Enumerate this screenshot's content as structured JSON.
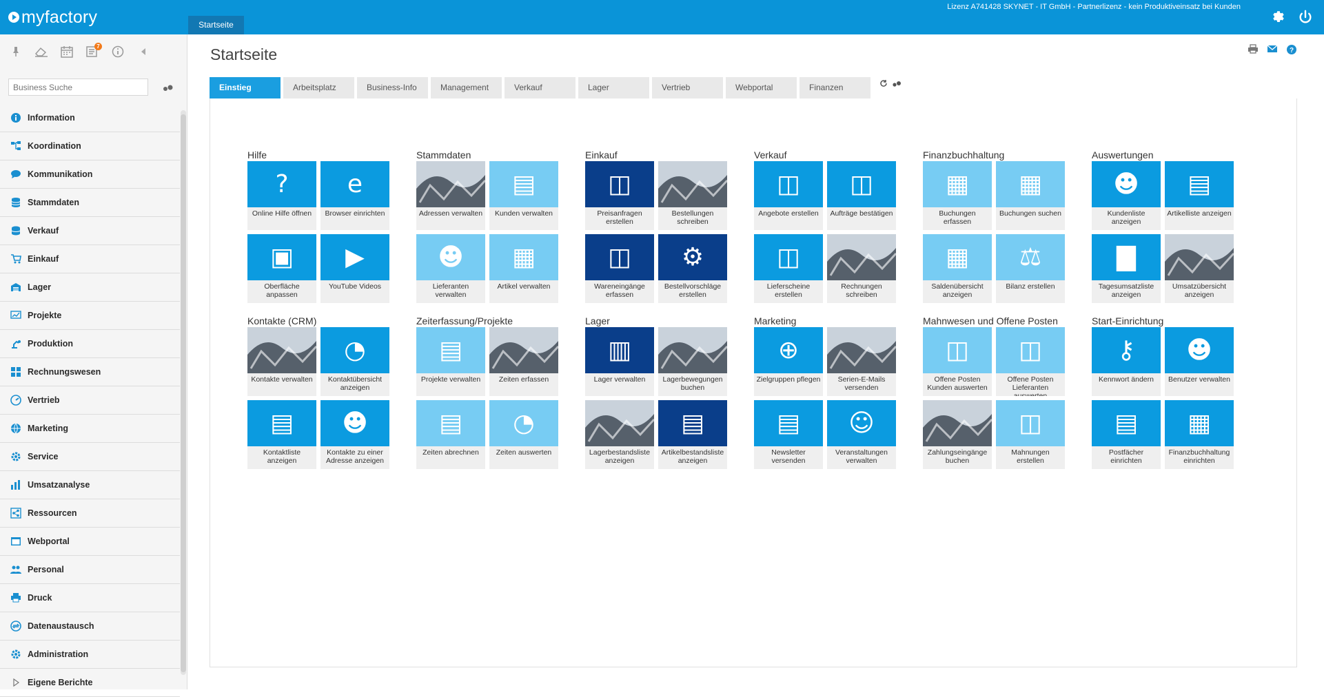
{
  "app": {
    "brand": "myfactory",
    "license": "Lizenz A741428 SKYNET - IT GmbH - Partnerlizenz - kein Produktiveinsatz bei Kunden",
    "open_tab": "Startseite"
  },
  "colors": {
    "topbar": "#0a94d8",
    "tile_blue": "#0b9be0",
    "tile_light": "#77ccf3",
    "tile_navy": "#0a3e8a",
    "tab_active": "#1a9ee0"
  },
  "sidebar": {
    "toolbar_badge": "7",
    "search_placeholder": "Business Suche",
    "items": [
      {
        "label": "Information",
        "icon": "info-icon"
      },
      {
        "label": "Koordination",
        "icon": "hierarchy-icon"
      },
      {
        "label": "Kommunikation",
        "icon": "chat-icon"
      },
      {
        "label": "Stammdaten",
        "icon": "database-icon"
      },
      {
        "label": "Verkauf",
        "icon": "coins-icon"
      },
      {
        "label": "Einkauf",
        "icon": "cart-icon"
      },
      {
        "label": "Lager",
        "icon": "warehouse-icon"
      },
      {
        "label": "Projekte",
        "icon": "chart-board-icon"
      },
      {
        "label": "Produktion",
        "icon": "robot-arm-icon"
      },
      {
        "label": "Rechnungswesen",
        "icon": "grid-icon"
      },
      {
        "label": "Vertrieb",
        "icon": "gauge-icon"
      },
      {
        "label": "Marketing",
        "icon": "globe-icon"
      },
      {
        "label": "Service",
        "icon": "gear-icon"
      },
      {
        "label": "Umsatzanalyse",
        "icon": "bar-chart-icon"
      },
      {
        "label": "Ressourcen",
        "icon": "share-icon"
      },
      {
        "label": "Webportal",
        "icon": "browser-icon"
      },
      {
        "label": "Personal",
        "icon": "people-icon"
      },
      {
        "label": "Druck",
        "icon": "printer-icon"
      },
      {
        "label": "Datenaustausch",
        "icon": "exchange-icon"
      },
      {
        "label": "Administration",
        "icon": "settings-icon"
      },
      {
        "label": "Eigene Berichte",
        "icon": "triangle-right-icon"
      }
    ]
  },
  "main": {
    "title": "Startseite",
    "tabs": [
      "Einstieg",
      "Arbeitsplatz",
      "Business-Info",
      "Management",
      "Verkauf",
      "Lager",
      "Vertrieb",
      "Webportal",
      "Finanzen"
    ],
    "groups": [
      {
        "title": "Hilfe",
        "tiles": [
          {
            "label": "Online Hilfe öffnen",
            "style": "blue",
            "glyph": "?"
          },
          {
            "label": "Browser einrichten",
            "style": "blue",
            "glyph": "e"
          },
          {
            "label": "Oberfläche anpassen",
            "style": "blue",
            "glyph": "▣"
          },
          {
            "label": "YouTube Videos",
            "style": "blue",
            "glyph": "▶"
          }
        ]
      },
      {
        "title": "Stammdaten",
        "tiles": [
          {
            "label": "Adressen verwalten",
            "style": "photo",
            "glyph": ""
          },
          {
            "label": "Kunden verwalten",
            "style": "light",
            "glyph": "▤"
          },
          {
            "label": "Lieferanten verwalten",
            "style": "light",
            "glyph": "☻"
          },
          {
            "label": "Artikel verwalten",
            "style": "light",
            "glyph": "▦"
          }
        ]
      },
      {
        "title": "Einkauf",
        "tiles": [
          {
            "label": "Preisanfragen erstellen",
            "style": "navy",
            "glyph": "◫"
          },
          {
            "label": "Bestellungen schreiben",
            "style": "photo",
            "glyph": ""
          },
          {
            "label": "Wareneingänge erfassen",
            "style": "navy",
            "glyph": "◫"
          },
          {
            "label": "Bestellvorschläge erstellen",
            "style": "navy",
            "glyph": "⚙"
          }
        ]
      },
      {
        "title": "Verkauf",
        "tiles": [
          {
            "label": "Angebote erstellen",
            "style": "blue",
            "glyph": "◫"
          },
          {
            "label": "Aufträge bestätigen",
            "style": "blue",
            "glyph": "◫"
          },
          {
            "label": "Lieferscheine erstellen",
            "style": "blue",
            "glyph": "◫"
          },
          {
            "label": "Rechnungen schreiben",
            "style": "photo",
            "glyph": ""
          }
        ]
      },
      {
        "title": "Finanzbuchhaltung",
        "tiles": [
          {
            "label": "Buchungen erfassen",
            "style": "light",
            "glyph": "▦"
          },
          {
            "label": "Buchungen suchen",
            "style": "light",
            "glyph": "▦"
          },
          {
            "label": "Saldenübersicht anzeigen",
            "style": "light",
            "glyph": "▦"
          },
          {
            "label": "Bilanz erstellen",
            "style": "light",
            "glyph": "⚖"
          }
        ]
      },
      {
        "title": "Auswertungen",
        "tiles": [
          {
            "label": "Kundenliste anzeigen",
            "style": "blue",
            "glyph": "☻"
          },
          {
            "label": "Artikelliste anzeigen",
            "style": "blue",
            "glyph": "▤"
          },
          {
            "label": "Tagesumsatzliste anzeigen",
            "style": "blue",
            "glyph": "▇"
          },
          {
            "label": "Umsatzübersicht anzeigen",
            "style": "photo",
            "glyph": ""
          }
        ]
      },
      {
        "title": "Kontakte (CRM)",
        "tiles": [
          {
            "label": "Kontakte verwalten",
            "style": "photo",
            "glyph": ""
          },
          {
            "label": "Kontaktübersicht anzeigen",
            "style": "blue",
            "glyph": "◔"
          },
          {
            "label": "Kontaktliste anzeigen",
            "style": "blue",
            "glyph": "▤"
          },
          {
            "label": "Kontakte zu einer Adresse anzeigen",
            "style": "blue",
            "glyph": "☻"
          }
        ]
      },
      {
        "title": "Zeiterfassung/Projekte",
        "tiles": [
          {
            "label": "Projekte verwalten",
            "style": "light",
            "glyph": "▤"
          },
          {
            "label": "Zeiten erfassen",
            "style": "photo",
            "glyph": ""
          },
          {
            "label": "Zeiten abrechnen",
            "style": "light",
            "glyph": "▤"
          },
          {
            "label": "Zeiten auswerten",
            "style": "light",
            "glyph": "◔"
          }
        ]
      },
      {
        "title": "Lager",
        "tiles": [
          {
            "label": "Lager verwalten",
            "style": "navy",
            "glyph": "▥"
          },
          {
            "label": "Lagerbewegungen buchen",
            "style": "photo",
            "glyph": ""
          },
          {
            "label": "Lagerbestandsliste anzeigen",
            "style": "photo",
            "glyph": ""
          },
          {
            "label": "Artikelbestandsliste anzeigen",
            "style": "navy",
            "glyph": "▤"
          }
        ]
      },
      {
        "title": "Marketing",
        "tiles": [
          {
            "label": "Zielgruppen pflegen",
            "style": "blue",
            "glyph": "⊕"
          },
          {
            "label": "Serien-E-Mails versenden",
            "style": "photo",
            "glyph": ""
          },
          {
            "label": "Newsletter versenden",
            "style": "blue",
            "glyph": "▤"
          },
          {
            "label": "Veranstaltungen verwalten",
            "style": "blue",
            "glyph": "☺"
          }
        ]
      },
      {
        "title": "Mahnwesen und Offene Posten",
        "tiles": [
          {
            "label": "Offene Posten Kunden auswerten",
            "style": "light",
            "glyph": "◫"
          },
          {
            "label": "Offene Posten Lieferanten auswerten",
            "style": "light",
            "glyph": "◫"
          },
          {
            "label": "Zahlungseingänge buchen",
            "style": "photo",
            "glyph": ""
          },
          {
            "label": "Mahnungen erstellen",
            "style": "light",
            "glyph": "◫"
          }
        ]
      },
      {
        "title": "Start-Einrichtung",
        "tiles": [
          {
            "label": "Kennwort ändern",
            "style": "blue",
            "glyph": "⚷"
          },
          {
            "label": "Benutzer verwalten",
            "style": "blue",
            "glyph": "☻"
          },
          {
            "label": "Postfächer einrichten",
            "style": "blue",
            "glyph": "▤"
          },
          {
            "label": "Finanzbuchhaltung einrichten",
            "style": "blue",
            "glyph": "▦"
          }
        ]
      }
    ]
  }
}
